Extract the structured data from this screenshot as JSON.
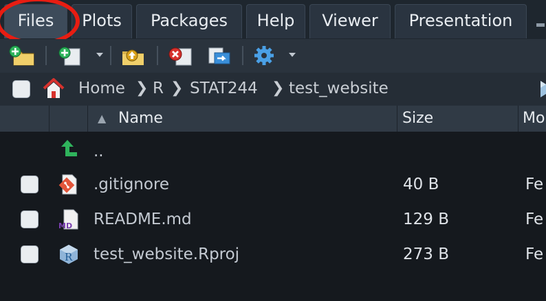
{
  "tabs": [
    {
      "label": "Files",
      "active": true
    },
    {
      "label": "Plots"
    },
    {
      "label": "Packages"
    },
    {
      "label": "Help"
    },
    {
      "label": "Viewer"
    },
    {
      "label": "Presentation"
    }
  ],
  "toolbar": {
    "icons": [
      "new-folder-icon",
      "new-file-icon",
      "upload-icon",
      "delete-icon",
      "rename-icon",
      "gear-icon"
    ]
  },
  "breadcrumb": {
    "items": [
      "Home",
      "R",
      "STAT244",
      "test_website"
    ],
    "separator": "❯"
  },
  "table": {
    "columns": {
      "name": "Name",
      "size": "Size",
      "modified": "Mo"
    },
    "sort_indicator": "▲",
    "parent_label": "..",
    "rows": [
      {
        "name": ".gitignore",
        "size": "40 B",
        "modified": "Fe",
        "icon": "git-file-icon"
      },
      {
        "name": "README.md",
        "size": "129 B",
        "modified": "Fe",
        "icon": "markdown-file-icon"
      },
      {
        "name": "test_website.Rproj",
        "size": "273 B",
        "modified": "Fe",
        "icon": "rproj-file-icon"
      }
    ]
  },
  "colors": {
    "annotation": "#e81d12",
    "background": "#15191e",
    "accent_green": "#2fb35c"
  },
  "icon_text": {
    "md": "MD",
    "r": "R"
  }
}
